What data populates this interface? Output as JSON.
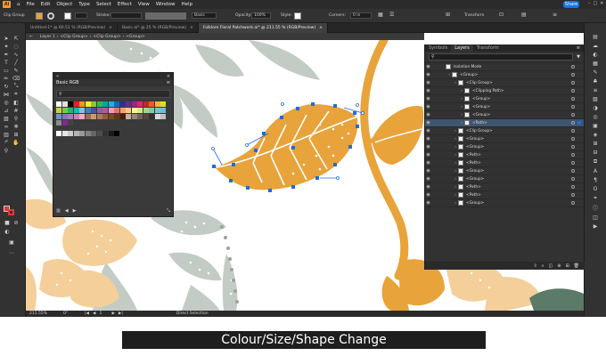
{
  "app": {
    "logo": "Ai",
    "menu": [
      "File",
      "Edit",
      "Object",
      "Type",
      "Select",
      "Effect",
      "View",
      "Window",
      "Help"
    ],
    "share_label": "Share"
  },
  "control_bar": {
    "selection_label": "Clip Group",
    "stroke_label": "Stroke:",
    "opacity_label": "Opacity:",
    "opacity_value": "100%",
    "style_label": "Style:",
    "corners_label": "Corners:",
    "corners_value": "0 in",
    "brush_value": "Basic",
    "transform_label": "Transform"
  },
  "tabs": [
    {
      "label": "Untitled-1* @ 60.51 % (RGB/Preview)",
      "active": false
    },
    {
      "label": "Basic.ai* @ 25 % (RGB/Preview)",
      "active": false
    },
    {
      "label": "Folklore Floral Patchwork.ai* @ 211.55 % (RGB/Preview)",
      "active": true
    }
  ],
  "breadcrumb": [
    "Layer 1",
    "<Clip Group>",
    "<Clip Group>",
    "<Group>"
  ],
  "swatch_panel": {
    "title": "Basic RGB",
    "colors": [
      "#ffffff",
      "#e0e0e0",
      "#000000",
      "#ec1c24",
      "#f7931e",
      "#fcee21",
      "#8cc63f",
      "#39b54a",
      "#00a99d",
      "#29abe2",
      "#0071bc",
      "#2e3192",
      "#662d91",
      "#93278f",
      "#ed1e79",
      "#c1272d",
      "#f15a24",
      "#fbb03b",
      "#d9e021",
      "#c6d33f",
      "#7ac943",
      "#22b573",
      "#1bbab0",
      "#7fc4e3",
      "#3f7dc0",
      "#4d4fa3",
      "#8f5fa8",
      "#b4589c",
      "#f49ac1",
      "#e3756e",
      "#f5a26b",
      "#fcc98b",
      "#fff799",
      "#d9e68b",
      "#a7d18b",
      "#7ec9a7",
      "#71c8c3",
      "#71b8e0",
      "#6e8fc9",
      "#7f78b8",
      "#a77bb5",
      "#c583b8",
      "#f4a9c6",
      "#9e6b4f",
      "#c69c6d",
      "#a67c52",
      "#8c6239",
      "#754c24",
      "#603813",
      "#42210b",
      "#c7b299",
      "#998675",
      "#736357",
      "#534741",
      "#362f2d",
      "#dcdcdc",
      "#bfbfbf",
      "#8c8c8c",
      "#7c2c90",
      "#444444"
    ],
    "grays": [
      "#ffffff",
      "#e6e6e6",
      "#cccccc",
      "#b3b3b3",
      "#999999",
      "#808080",
      "#666666",
      "#4d4d4d",
      "#333333",
      "#1a1a1a",
      "#000000"
    ]
  },
  "layers_panel": {
    "tabs": [
      "Symbols",
      "Layers",
      "Transform"
    ],
    "items": [
      {
        "label": "Isolation Mode",
        "indent": 0,
        "selected": false
      },
      {
        "label": "<Group>",
        "indent": 1,
        "selected": false
      },
      {
        "label": "<Clip Group>",
        "indent": 2,
        "selected": false
      },
      {
        "label": "<Clipping Path>",
        "indent": 3,
        "selected": false
      },
      {
        "label": "<Group>",
        "indent": 3,
        "selected": false
      },
      {
        "label": "<Group>",
        "indent": 3,
        "selected": false
      },
      {
        "label": "<Group>",
        "indent": 3,
        "selected": false
      },
      {
        "label": "<Path>",
        "indent": 3,
        "selected": true
      },
      {
        "label": "<Clip Group>",
        "indent": 2,
        "selected": false
      },
      {
        "label": "<Group>",
        "indent": 2,
        "selected": false
      },
      {
        "label": "<Group>",
        "indent": 2,
        "selected": false
      },
      {
        "label": "<Path>",
        "indent": 2,
        "selected": false
      },
      {
        "label": "<Path>",
        "indent": 2,
        "selected": false
      },
      {
        "label": "<Group>",
        "indent": 2,
        "selected": false
      },
      {
        "label": "<Group>",
        "indent": 2,
        "selected": false
      },
      {
        "label": "<Path>",
        "indent": 2,
        "selected": false
      },
      {
        "label": "<Path>",
        "indent": 2,
        "selected": false
      },
      {
        "label": "<Group>",
        "indent": 2,
        "selected": false
      }
    ]
  },
  "status_bar": {
    "zoom": "211.55%",
    "angle": "0°",
    "artboard": "1",
    "tool": "Direct Selection"
  },
  "caption": "Colour/Size/Shape Change"
}
